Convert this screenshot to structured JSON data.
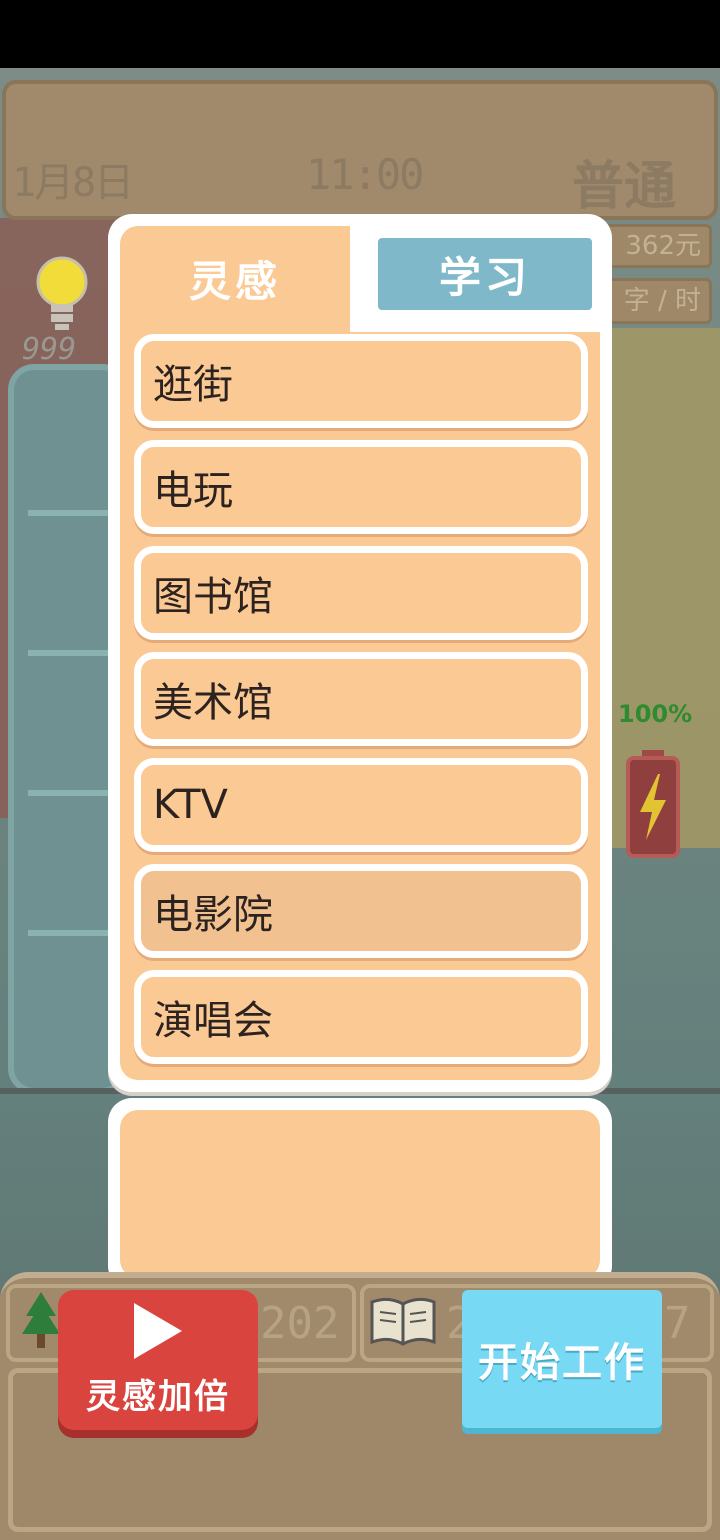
{
  "topbar": {
    "date": "1月8日",
    "time": "11:00",
    "mode": "普通"
  },
  "stats": {
    "money": "362元",
    "speed": "字 / 时",
    "inspiration": "999",
    "battery": "100%"
  },
  "tabs": {
    "inspiration": "灵感",
    "study": "学习"
  },
  "activities": [
    "逛街",
    "电玩",
    "图书馆",
    "美术馆",
    "KTV",
    "电影院",
    "演唱会"
  ],
  "description": "",
  "bottom": {
    "tree_count": "202",
    "book_count": "2",
    "right_value": "7"
  },
  "buttons": {
    "double": "灵感加倍",
    "start_work": "开始工作"
  },
  "colors": {
    "panel": "#fbc994",
    "study_tab": "#7fb9c9",
    "double_button": "#d9443f",
    "work_button": "#77d9f3"
  }
}
